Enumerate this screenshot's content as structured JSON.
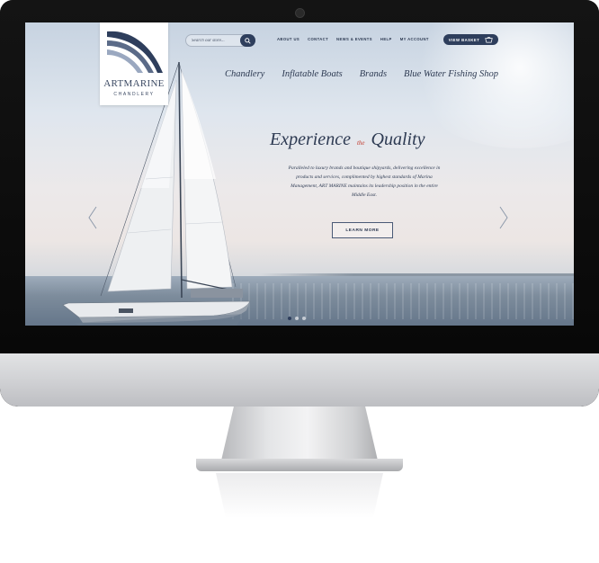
{
  "brand": {
    "name_prefix": "ART",
    "name_suffix": "MARINE",
    "subtitle": "CHANDLERY"
  },
  "search": {
    "placeholder": "Search our store..."
  },
  "top_nav": [
    "ABOUT US",
    "CONTACT",
    "NEWS & EVENTS",
    "HELP",
    "MY ACCOUNT"
  ],
  "basket": {
    "label": "VIEW BASKET"
  },
  "main_nav": [
    "Chandlery",
    "Inflatable Boats",
    "Brands",
    "Blue Water Fishing Shop"
  ],
  "hero": {
    "title_part1": "Experience",
    "title_connector": "the",
    "title_part2": "Quality",
    "text": "Paralleled to luxury brands and boutique shipyards, delivering excellence in products and services, complimented by highest standards of Marina Management, ART MARINE maintains its leadership position in the entire Middle East.",
    "cta_label": "LEARN MORE"
  },
  "slider": {
    "slide_count": 3,
    "active_index": 0
  },
  "colors": {
    "navy": "#2e3e5c",
    "accent_red": "#c0392b"
  }
}
